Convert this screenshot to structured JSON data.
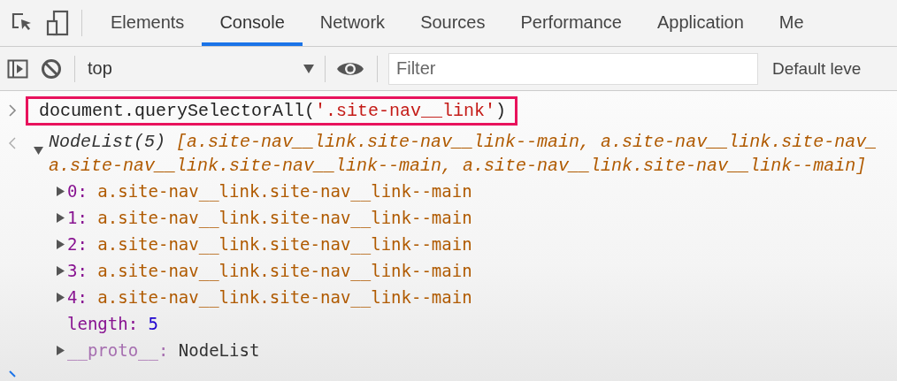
{
  "tabs": [
    {
      "label": "Elements",
      "selected": false
    },
    {
      "label": "Console",
      "selected": true
    },
    {
      "label": "Network",
      "selected": false
    },
    {
      "label": "Sources",
      "selected": false
    },
    {
      "label": "Performance",
      "selected": false
    },
    {
      "label": "Application",
      "selected": false
    },
    {
      "label": "Me",
      "selected": false
    }
  ],
  "toolbar": {
    "context": "top",
    "filter": {
      "placeholder": "Filter"
    },
    "levels": "Default leve"
  },
  "console": {
    "input": {
      "highlighted": true,
      "code": "document.querySelectorAll(",
      "string": "'.site-nav__link'",
      "close": ")"
    },
    "result": {
      "expanded": true,
      "type": "NodeList(5)",
      "summary_lines": [
        "[a.site-nav__link.site-nav__link--main, a.site-nav__link.site-nav_",
        "a.site-nav__link.site-nav__link--main, a.site-nav__link.site-nav__link--main]"
      ],
      "properties": [
        {
          "kind": "node",
          "key": "0:",
          "value": "a.site-nav__link.site-nav__link--main",
          "expanded": false
        },
        {
          "kind": "node",
          "key": "1:",
          "value": "a.site-nav__link.site-nav__link--main",
          "expanded": false
        },
        {
          "kind": "node",
          "key": "2:",
          "value": "a.site-nav__link.site-nav__link--main",
          "expanded": false
        },
        {
          "kind": "node",
          "key": "3:",
          "value": "a.site-nav__link.site-nav__link--main",
          "expanded": false
        },
        {
          "kind": "node",
          "key": "4:",
          "value": "a.site-nav__link.site-nav__link--main",
          "expanded": false
        },
        {
          "kind": "number",
          "key": "length:",
          "value": "5"
        },
        {
          "kind": "proto",
          "key": "__proto__:",
          "value": "NodeList",
          "expanded": false
        }
      ]
    }
  }
}
